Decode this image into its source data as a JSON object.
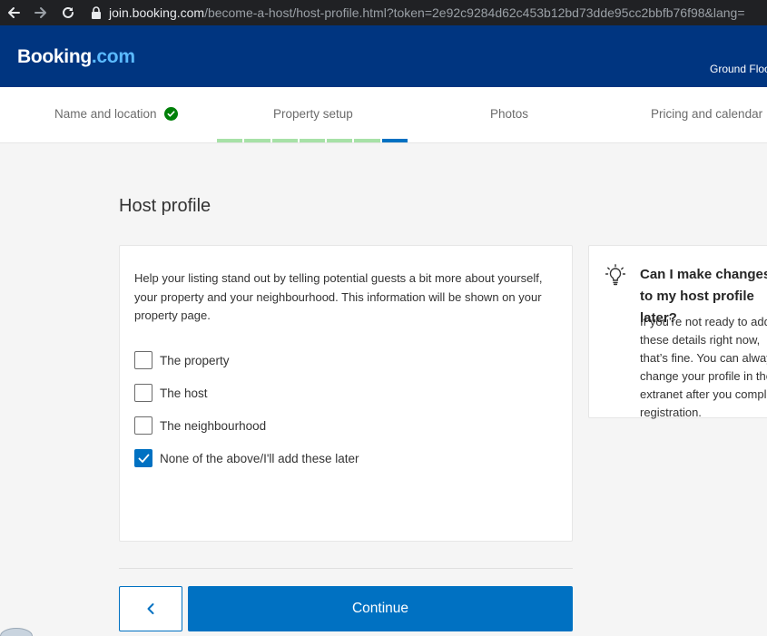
{
  "browser": {
    "url_domain": "join.booking.com",
    "url_path": "/become-a-host/host-profile.html?token=2e92c9284d62c453b12bd73dde95cc2bbfb76f98&lang="
  },
  "header": {
    "logo_main": "Booking",
    "logo_suffix": ".com",
    "right_text": "Ground Floo"
  },
  "steps": [
    {
      "label": "Name and location",
      "complete": true
    },
    {
      "label": "Property setup",
      "complete": false
    },
    {
      "label": "Photos",
      "complete": false
    },
    {
      "label": "Pricing and calendar",
      "complete": false
    }
  ],
  "progress": {
    "segments_total": 7,
    "segments_done": 6
  },
  "page": {
    "title": "Host profile",
    "intro": "Help your listing stand out by telling potential guests a bit more about yourself, your property and your neighbourhood. This information will be shown on your property page.",
    "options": [
      {
        "label": "The property",
        "checked": false
      },
      {
        "label": "The host",
        "checked": false
      },
      {
        "label": "The neighbourhood",
        "checked": false
      },
      {
        "label": "None of the above/I'll add these later",
        "checked": true
      }
    ],
    "continue_label": "Continue"
  },
  "info": {
    "title": "Can I make changes to my host profile later?",
    "body": "If you’re not ready to add these details right now, that’s fine. You can always change your profile in the extranet after you complete registration."
  },
  "colors": {
    "header_bg": "#003580",
    "primary": "#0071c2",
    "success": "#008009",
    "progress_done": "#a7e1a7"
  },
  "icons": {
    "back": "arrow-left-icon",
    "forward": "arrow-right-icon",
    "reload": "reload-icon",
    "lock": "lock-icon",
    "step_done": "check-circle-icon",
    "checkbox": "checkmark-icon",
    "back_button": "chevron-left-icon",
    "info": "lightbulb-icon"
  }
}
